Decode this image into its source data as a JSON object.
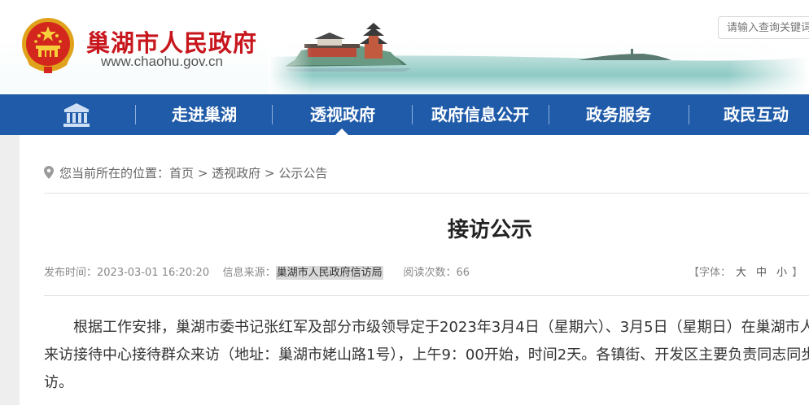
{
  "header": {
    "site_title": "巢湖市人民政府",
    "site_url": "www.chaohu.gov.cn",
    "search_placeholder": "请输入查询关键词"
  },
  "nav": {
    "home_icon": "building-columns-icon",
    "items": [
      "走进巢湖",
      "透视政府",
      "政府信息公开",
      "政务服务",
      "政民互动"
    ],
    "active": "透视政府",
    "color": "#1f5ba8"
  },
  "breadcrumb": {
    "prefix": "您当前所在的位置：",
    "items": [
      "首页",
      "透视政府",
      "公示公告"
    ],
    "separator": ">"
  },
  "article": {
    "title": "接访公示",
    "meta": {
      "publish_label": "发布时间：",
      "publish_time": "2023-03-01 16:20:20",
      "source_label": "信息来源：",
      "source": "巢湖市人民政府信访局",
      "views_label": "阅读次数：",
      "views": "66"
    },
    "font_size": {
      "open": "【字体：",
      "large": "大",
      "medium": "中",
      "small": "小",
      "close": "】"
    },
    "lines": [
      "根据工作安排，巢湖市委书记张红军及部分市级领导定于2023年3月4日（星期六）、3月5日（星期日）在巢湖市人",
      "来访接待中心接待群众来访（地址：巢湖市姥山路1号），上午9：00开始，时间2天。各镇街、开发区主要负责同志同步",
      "访。"
    ]
  }
}
